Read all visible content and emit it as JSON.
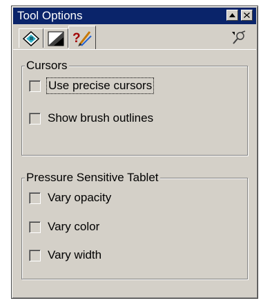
{
  "window": {
    "title": "Tool Options",
    "buttons": [
      {
        "name": "maximize",
        "icon": "triangle-up-icon"
      },
      {
        "name": "close",
        "icon": "close-icon"
      }
    ]
  },
  "tabs": [
    {
      "icon": "paint-bucket-icon",
      "active": false
    },
    {
      "icon": "gradient-icon",
      "active": false
    },
    {
      "icon": "brush-settings-icon",
      "active": true
    }
  ],
  "toolbar": {
    "options_icon": "pin-options-icon"
  },
  "cursors": {
    "label": "Cursors",
    "options": [
      {
        "label": "Use precise cursors",
        "checked": false,
        "focused": true
      },
      {
        "label": "Show brush outlines",
        "checked": false,
        "focused": false
      }
    ]
  },
  "pressure": {
    "label": "Pressure Sensitive Tablet",
    "options": [
      {
        "label": "Vary opacity",
        "checked": false
      },
      {
        "label": "Vary color",
        "checked": false
      },
      {
        "label": "Vary width",
        "checked": false
      }
    ]
  },
  "colors": {
    "title_bar": "#0a246a",
    "face": "#d4d0c8",
    "shadow": "#808080",
    "highlight": "#ffffff"
  }
}
